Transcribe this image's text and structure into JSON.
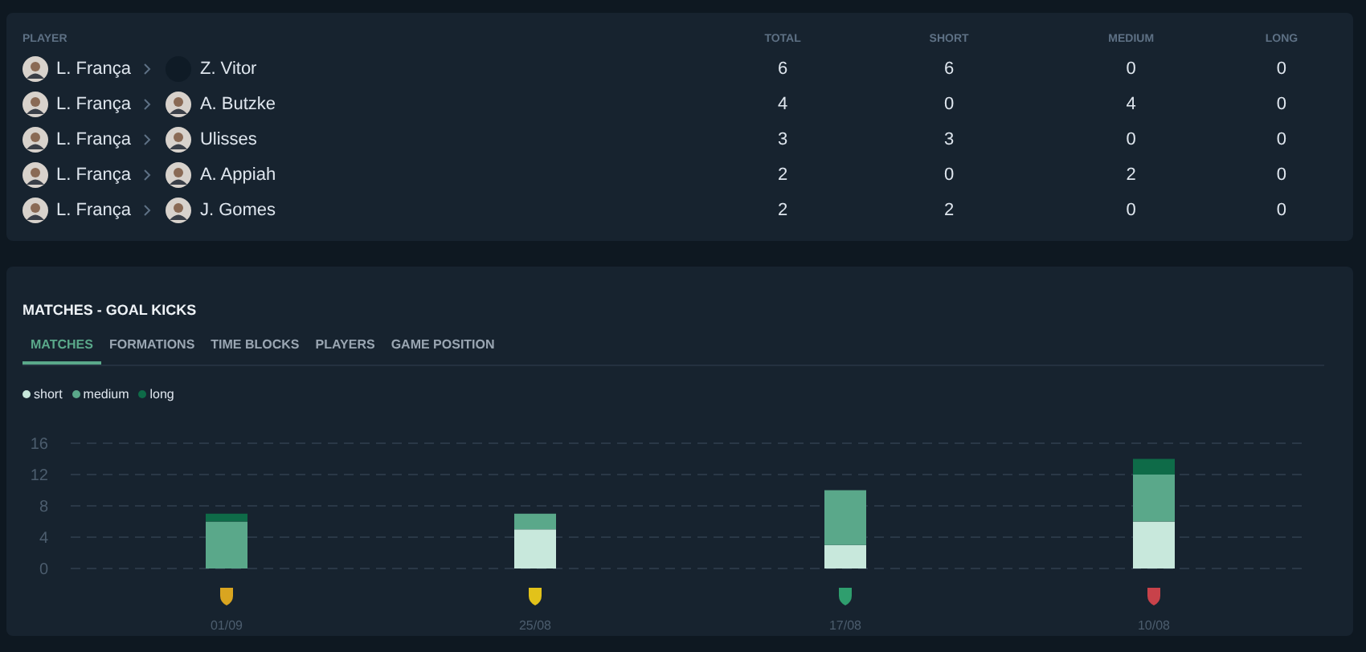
{
  "player_table": {
    "columns": [
      "PLAYER",
      "TOTAL",
      "SHORT",
      "MEDIUM",
      "LONG"
    ],
    "rows": [
      {
        "from": "L. França",
        "to": "Z. Vitor",
        "to_photo": false,
        "total": "6",
        "short": "6",
        "medium": "0",
        "long": "0"
      },
      {
        "from": "L. França",
        "to": "A. Butzke",
        "to_photo": true,
        "total": "4",
        "short": "0",
        "medium": "4",
        "long": "0"
      },
      {
        "from": "L. França",
        "to": "Ulisses",
        "to_photo": true,
        "total": "3",
        "short": "3",
        "medium": "0",
        "long": "0"
      },
      {
        "from": "L. França",
        "to": "A. Appiah",
        "to_photo": true,
        "total": "2",
        "short": "0",
        "medium": "2",
        "long": "0"
      },
      {
        "from": "L. França",
        "to": "J. Gomes",
        "to_photo": true,
        "total": "2",
        "short": "2",
        "medium": "0",
        "long": "0"
      }
    ]
  },
  "goal_kicks": {
    "title": "MATCHES - GOAL KICKS",
    "tabs": [
      {
        "label": "MATCHES",
        "selected": true
      },
      {
        "label": "FORMATIONS",
        "selected": false
      },
      {
        "label": "TIME BLOCKS",
        "selected": false
      },
      {
        "label": "PLAYERS",
        "selected": false
      },
      {
        "label": "GAME POSITION",
        "selected": false
      }
    ],
    "badges": [
      {
        "color": "#d9a520"
      },
      {
        "color": "#e2c21a"
      },
      {
        "color": "#2f9e6e"
      },
      {
        "color": "#c8424a"
      }
    ],
    "chart_data": {
      "type": "bar",
      "stacked": true,
      "categories": [
        "01/09",
        "25/08",
        "17/08",
        "10/08"
      ],
      "series": [
        {
          "name": "short",
          "color": "#c8e8dc",
          "values": [
            0,
            5,
            3,
            6
          ]
        },
        {
          "name": "medium",
          "color": "#5aa88a",
          "values": [
            6,
            2,
            7,
            6
          ]
        },
        {
          "name": "long",
          "color": "#0e6b48",
          "values": [
            1,
            0,
            0,
            2
          ]
        }
      ],
      "ylim": [
        0,
        16
      ],
      "grid": true,
      "yticks": [
        0,
        4,
        8,
        12,
        16
      ]
    }
  }
}
